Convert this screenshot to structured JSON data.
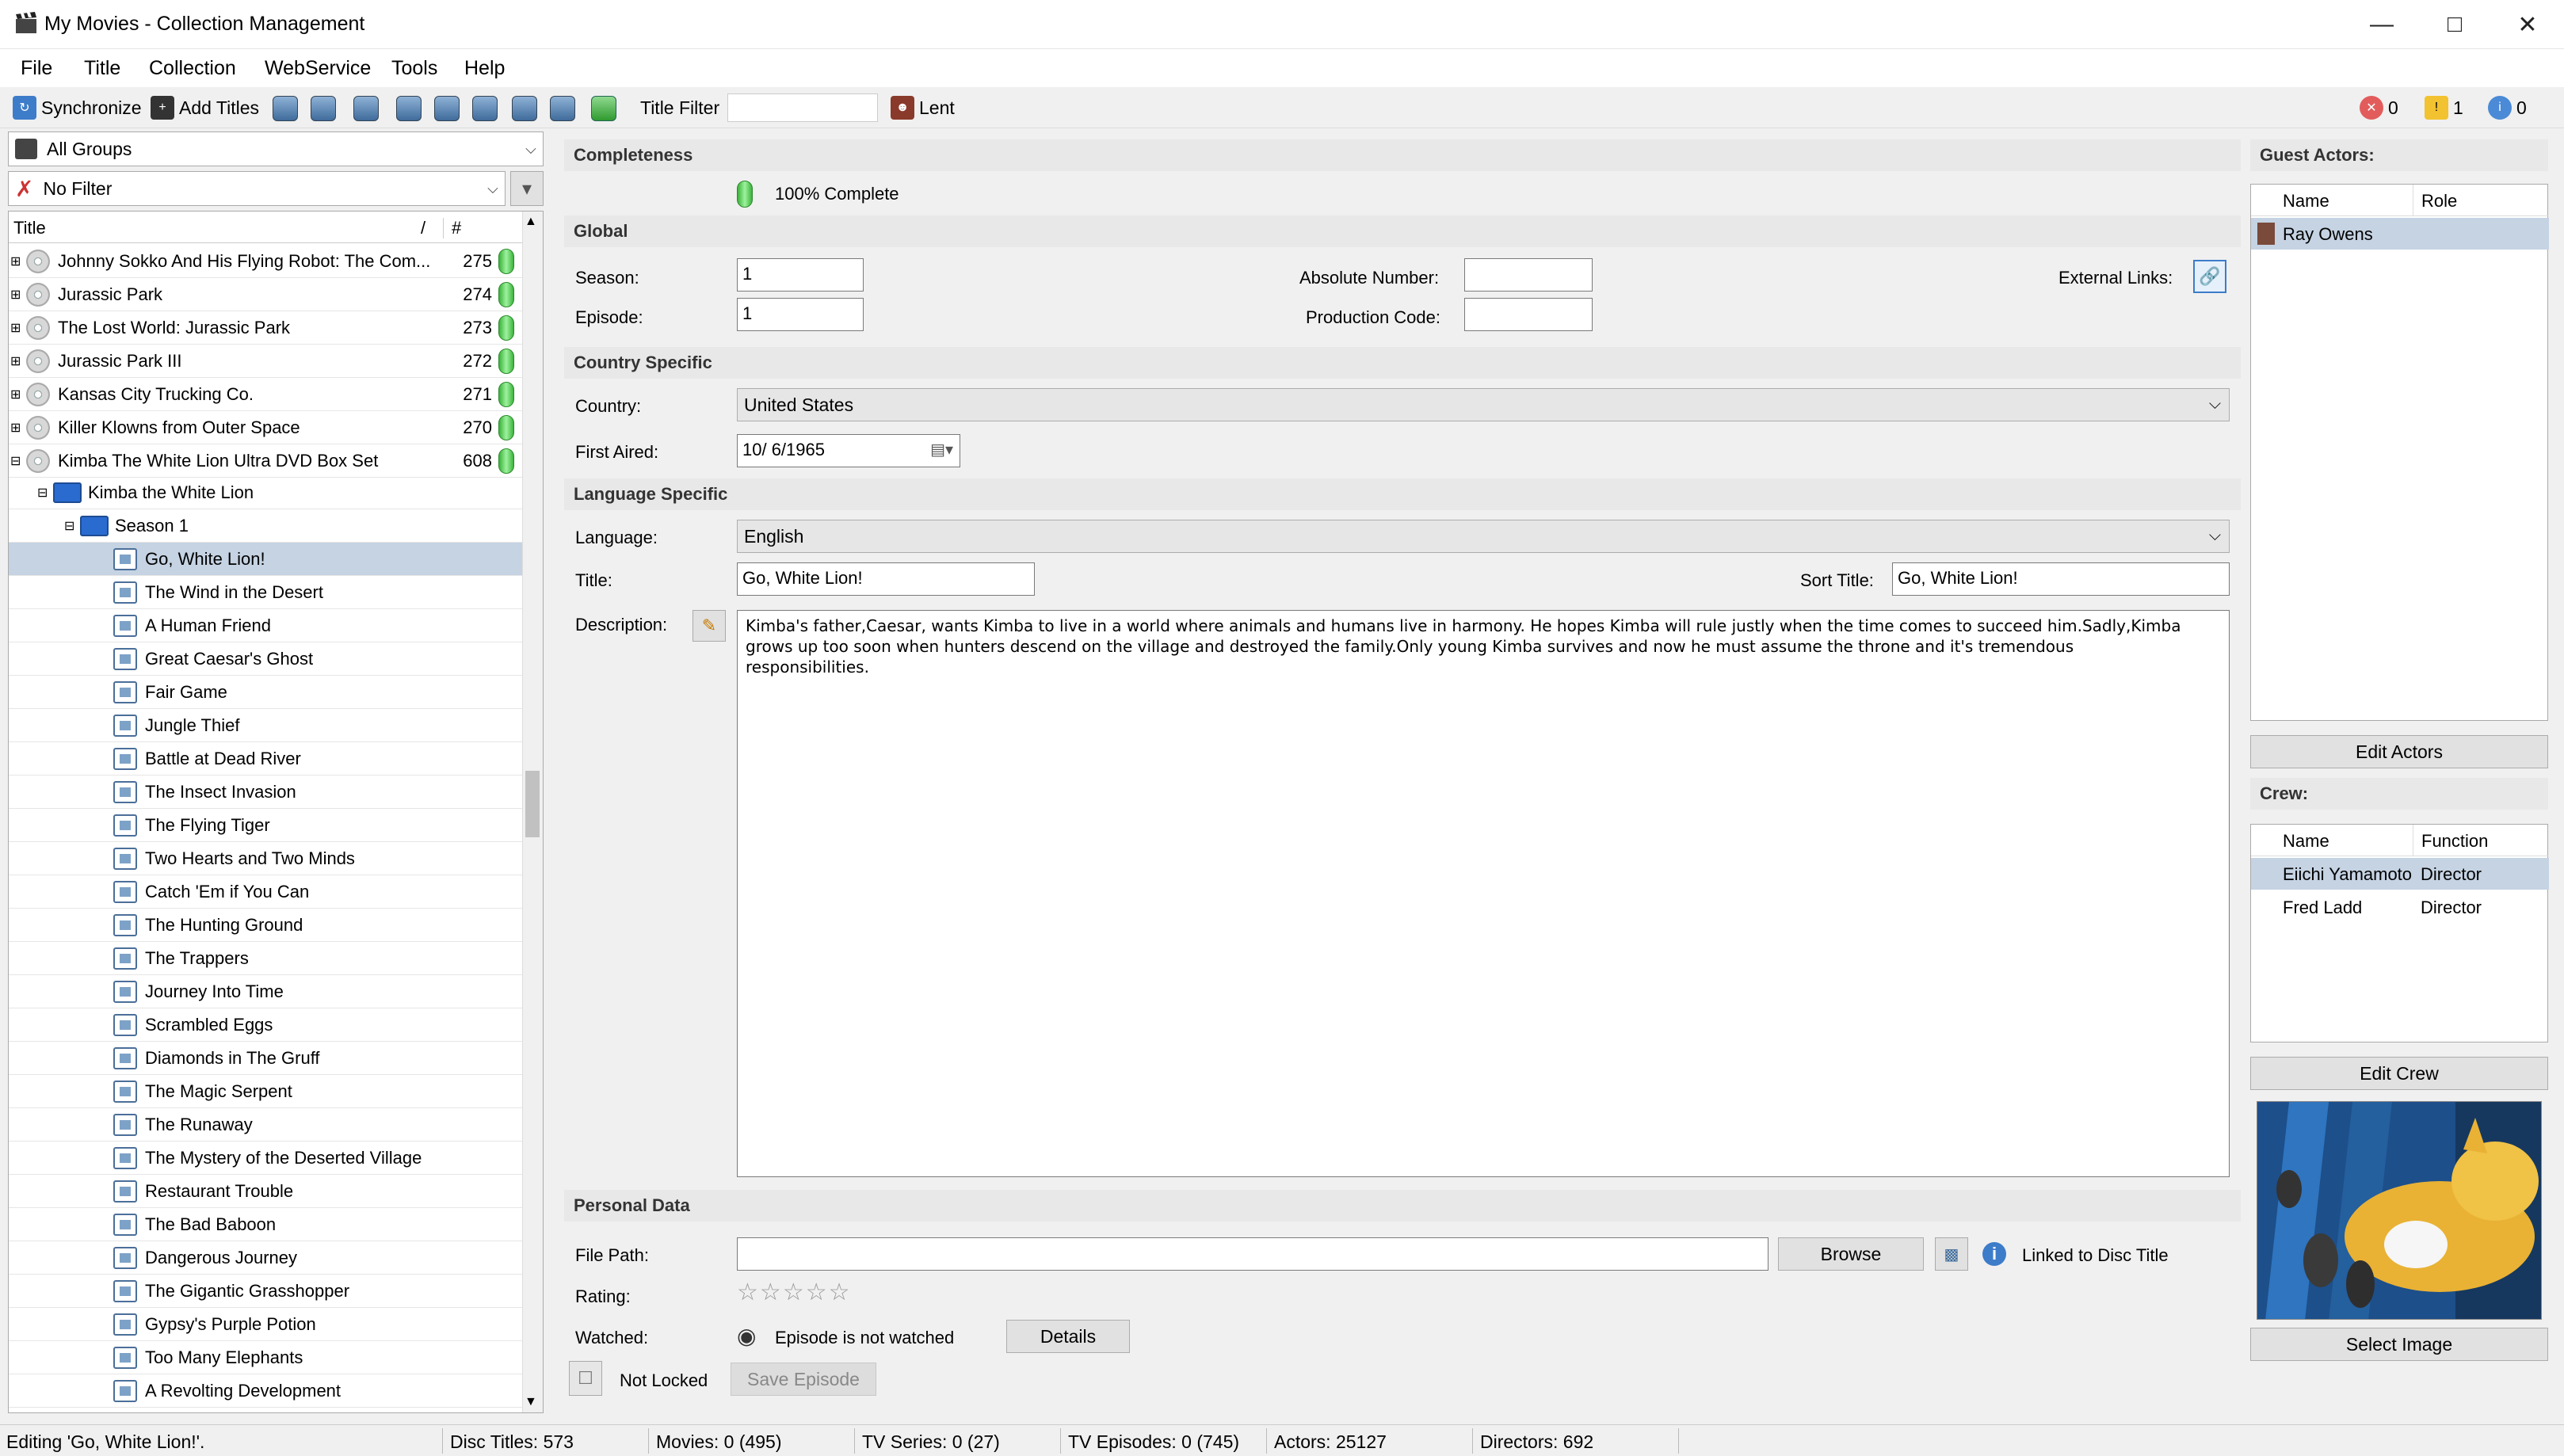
{
  "window": {
    "title": "My Movies - Collection Management"
  },
  "menu": [
    "File",
    "Title",
    "Collection",
    "WebService",
    "Tools",
    "Help"
  ],
  "toolbar": {
    "synchronize": "Synchronize",
    "add_titles": "Add Titles",
    "title_filter_label": "Title Filter",
    "title_filter_value": "",
    "lent": "Lent",
    "errors": "0",
    "warnings": "1",
    "info": "0"
  },
  "left": {
    "group": "All Groups",
    "filter": "No Filter",
    "col_title": "Title",
    "col_sort": "/",
    "col_count": "#",
    "titles": [
      {
        "label": "Johnny Sokko And His Flying Robot: The Com...",
        "count": "275"
      },
      {
        "label": "Jurassic Park",
        "count": "274"
      },
      {
        "label": "The Lost World: Jurassic Park",
        "count": "273"
      },
      {
        "label": "Jurassic Park III",
        "count": "272"
      },
      {
        "label": "Kansas City Trucking Co.",
        "count": "271"
      },
      {
        "label": "Killer Klowns from Outer Space",
        "count": "270"
      },
      {
        "label": "Kimba The White Lion Ultra DVD Box Set",
        "count": "608"
      }
    ],
    "series": "Kimba the White Lion",
    "season": "Season 1",
    "episodes": [
      "Go, White Lion!",
      "The Wind in the Desert",
      "A Human Friend",
      "Great Caesar's Ghost",
      "Fair Game",
      "Jungle Thief",
      "Battle at Dead River",
      "The Insect Invasion",
      "The Flying Tiger",
      "Two Hearts and Two Minds",
      "Catch 'Em if You Can",
      "The Hunting Ground",
      "The Trappers",
      "Journey Into Time",
      "Scrambled Eggs",
      "Diamonds in The Gruff",
      "The Magic Serpent",
      "The Runaway",
      "The Mystery of the Deserted Village",
      "Restaurant Trouble",
      "The Bad Baboon",
      "Dangerous Journey",
      "The Gigantic Grasshopper",
      "Gypsy's Purple Potion",
      "Too Many Elephants",
      "A Revolting Development"
    ]
  },
  "detail": {
    "completeness_head": "Completeness",
    "complete_text": "100% Complete",
    "global_head": "Global",
    "season_label": "Season:",
    "season_value": "1",
    "episode_label": "Episode:",
    "episode_value": "1",
    "absolute_label": "Absolute Number:",
    "absolute_value": "",
    "production_label": "Production Code:",
    "production_value": "",
    "external_label": "External Links:",
    "country_head": "Country Specific",
    "country_label": "Country:",
    "country_value": "United States",
    "first_aired_label": "First Aired:",
    "first_aired_value": "10/  6/1965",
    "language_head": "Language Specific",
    "language_label": "Language:",
    "language_value": "English",
    "title_label": "Title:",
    "title_value": "Go, White Lion!",
    "sort_title_label": "Sort Title:",
    "sort_title_value": "Go, White Lion!",
    "description_label": "Description:",
    "description_value": "Kimba's father,Caesar, wants Kimba to live in a world where animals and humans live in harmony. He hopes Kimba will rule justly when the time comes to succeed him.Sadly,Kimba grows up too soon when hunters descend on the village and destroyed the family.Only young Kimba survives and now he must assume the throne and it's tremendous responsibilities.",
    "personal_head": "Personal Data",
    "file_path_label": "File Path:",
    "file_path_value": "",
    "browse": "Browse",
    "linked": "Linked to Disc Title",
    "rating_label": "Rating:",
    "rating": 0,
    "watched_label": "Watched:",
    "watched_value": "Episode is not watched",
    "details": "Details",
    "locked": "Not Locked",
    "save": "Save Episode"
  },
  "right": {
    "guest_head": "Guest Actors:",
    "col_name": "Name",
    "col_role": "Role",
    "guests": [
      {
        "name": "Ray Owens",
        "role": ""
      }
    ],
    "edit_actors": "Edit Actors",
    "crew_head": "Crew:",
    "col_function": "Function",
    "crew": [
      {
        "name": "Eiichi Yamamoto",
        "function": "Director"
      },
      {
        "name": "Fred Ladd",
        "function": "Director"
      }
    ],
    "edit_crew": "Edit Crew",
    "select_image": "Select Image"
  },
  "status": {
    "editing": "Editing 'Go, White Lion!'.",
    "disc_titles": "Disc Titles: 573",
    "movies": "Movies: 0 (495)",
    "tv_series": "TV Series: 0 (27)",
    "tv_episodes": "TV Episodes: 0 (745)",
    "actors": "Actors: 25127",
    "directors": "Directors: 692"
  },
  "colors": {
    "accent": "#c5d3e3",
    "complete": "#3bb33b"
  }
}
